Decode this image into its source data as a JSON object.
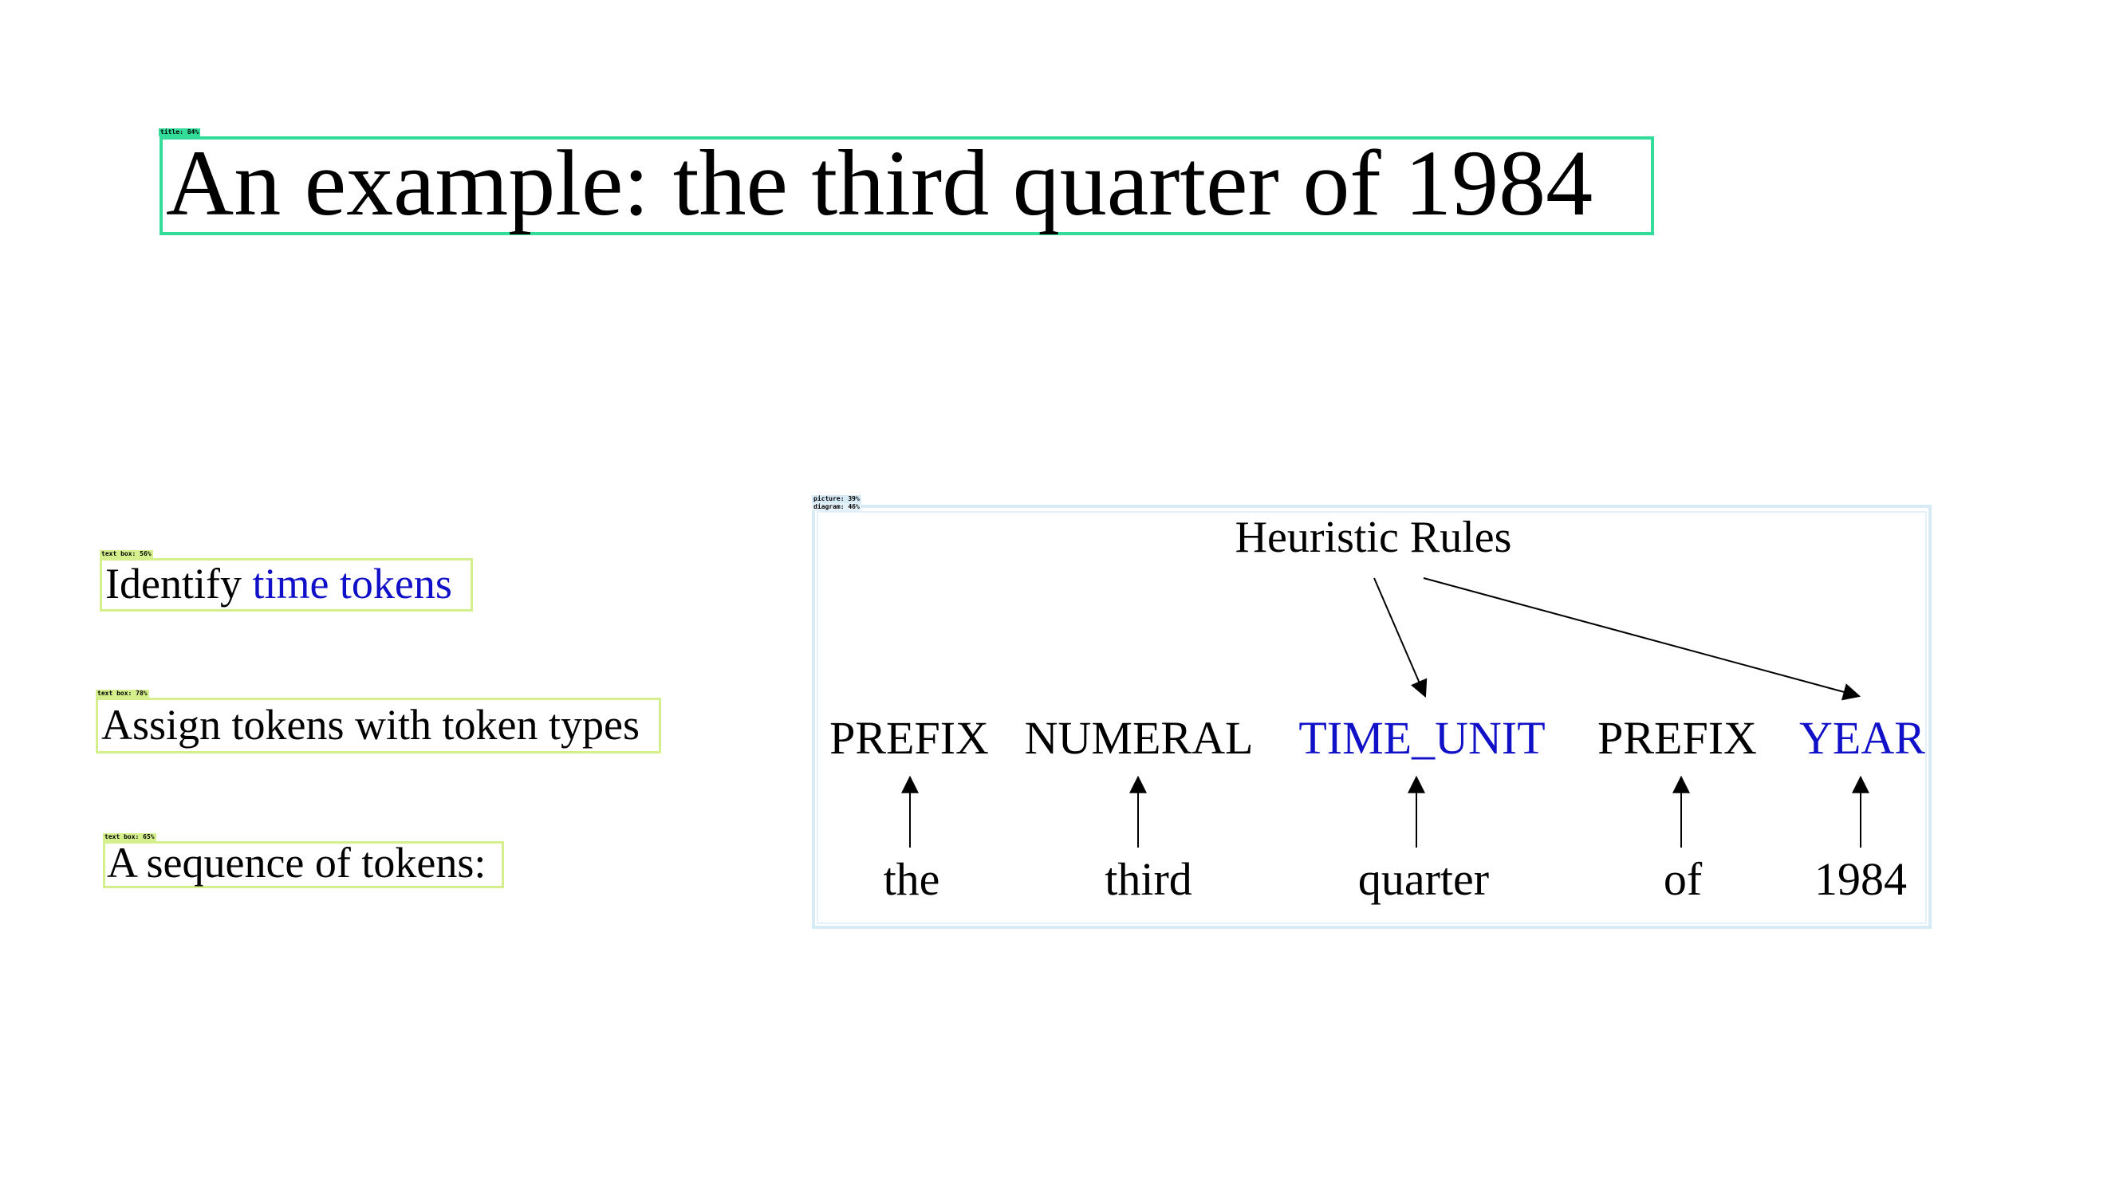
{
  "title": {
    "text": "An example: the third quarter of 1984",
    "detection_label": "title: 84%"
  },
  "text_boxes": [
    {
      "detection_label": "text box: 56%",
      "parts": [
        {
          "text": "Identify ",
          "color": "#000000"
        },
        {
          "text": "time tokens",
          "color": "#1010c8"
        }
      ]
    },
    {
      "detection_label": "text box: 78%",
      "parts": [
        {
          "text": "Assign tokens with token types",
          "color": "#000000"
        }
      ]
    },
    {
      "detection_label": "text box: 65%",
      "parts": [
        {
          "text": "A sequence of tokens:",
          "color": "#000000"
        }
      ]
    }
  ],
  "picture": {
    "detection_label": "picture: 39%",
    "diagram_label": "diagram: 46%"
  },
  "diagram": {
    "rules_label": "Heuristic Rules",
    "tokens": [
      {
        "word": "the",
        "type": "PREFIX",
        "type_color": "#000000",
        "highlighted": false
      },
      {
        "word": "third",
        "type": "NUMERAL",
        "type_color": "#000000",
        "highlighted": false
      },
      {
        "word": "quarter",
        "type": "TIME_UNIT",
        "type_color": "#1010c8",
        "highlighted": true
      },
      {
        "word": "of",
        "type": "PREFIX",
        "type_color": "#000000",
        "highlighted": false
      },
      {
        "word": "1984",
        "type": "YEAR",
        "type_color": "#1010c8",
        "highlighted": true
      }
    ]
  },
  "colors": {
    "highlight_blue": "#1010c8",
    "title_box": "#33dd99",
    "text_box": "#d4ef8c",
    "picture_box": "#d6ebf5"
  }
}
